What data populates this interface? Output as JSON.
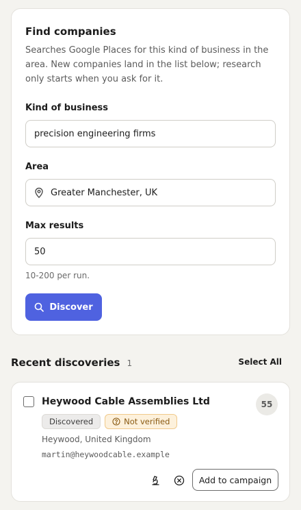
{
  "find": {
    "title": "Find companies",
    "description": "Searches Google Places for this kind of business in the area. New companies land in the list below; research only starts when you ask for it.",
    "kind_label": "Kind of business",
    "kind_value": "precision engineering firms",
    "area_label": "Area",
    "area_value": "Greater Manchester, UK",
    "max_label": "Max results",
    "max_value": "50",
    "hint": "10-200 per run.",
    "discover_label": "Discover"
  },
  "recent": {
    "title": "Recent discoveries",
    "count": "1",
    "select_all": "Select All"
  },
  "results": [
    {
      "name": "Heywood Cable Assemblies Ltd",
      "score": "55",
      "status_badge": "Discovered",
      "verification_badge": "Not verified",
      "location": "Heywood, United Kingdom",
      "email": "martin@heywoodcable.example",
      "add_label": "Add to campaign"
    }
  ],
  "colors": {
    "accent": "#4f62e0",
    "warning_bg": "#fdf1dc",
    "warning_text": "#8a5a12"
  }
}
